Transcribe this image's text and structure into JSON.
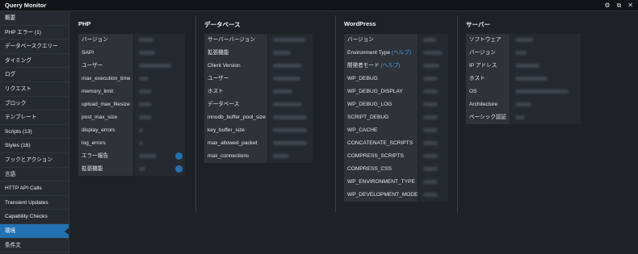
{
  "window": {
    "title": "Query Monitor"
  },
  "toolbar_icons": [
    "gear-icon",
    "new-window-icon",
    "close-icon"
  ],
  "toolbar_glyphs": {
    "gear": "⚙",
    "window": "⧉",
    "close": "✕"
  },
  "sidebar": {
    "items": [
      "概要",
      "PHP エラー (1)",
      "データベースクエリー",
      "タイミング",
      "ログ",
      "リクエスト",
      "ブロック",
      "テンプレート",
      "Scripts (13)",
      "Styles (16)",
      "フックとアクション",
      "言語",
      "HTTP API Calls",
      "Transient Updates",
      "Capability Checks",
      "環境",
      "条件文"
    ],
    "active_index": 15
  },
  "sections": {
    "php": {
      "title": "PHP",
      "rows": [
        "バージョン",
        "SAPI",
        "ユーザー",
        "max_execution_time",
        "memory_limit",
        "upload_max_filesize",
        "post_max_size",
        "display_errors",
        "log_errors",
        "エラー報告",
        "拡張機能"
      ]
    },
    "database": {
      "title": "データベース",
      "rows": [
        "サーバーバージョン",
        "拡張機能",
        "Client Version",
        "ユーザー",
        "ホスト",
        "データベース",
        "innodb_buffer_pool_size",
        "key_buffer_size",
        "max_allowed_packet",
        "max_connections"
      ]
    },
    "wordpress": {
      "title": "WordPress",
      "rows": [
        "バージョン",
        "Environment Type",
        "開発者モード",
        "WP_DEBUG",
        "WP_DEBUG_DISPLAY",
        "WP_DEBUG_LOG",
        "SCRIPT_DEBUG",
        "WP_CACHE",
        "CONCATENATE_SCRIPTS",
        "COMPRESS_SCRIPTS",
        "COMPRESS_CSS",
        "WP_ENVIRONMENT_TYPE",
        "WP_DEVELOPMENT_MODE"
      ],
      "help_label": "(ヘルプ)"
    },
    "server": {
      "title": "サーバー",
      "rows": [
        "ソフトウェア",
        "バージョン",
        "IP アドレス",
        "ホスト",
        "OS",
        "Architecture",
        "ベーシック認証"
      ]
    }
  },
  "colors": {
    "background": "#1d2227",
    "sidebar": "#262b31",
    "active": "#2271b1",
    "key_cell": "#2d3339",
    "value_cell": "#252a30",
    "help_link": "#4fa3e6"
  }
}
